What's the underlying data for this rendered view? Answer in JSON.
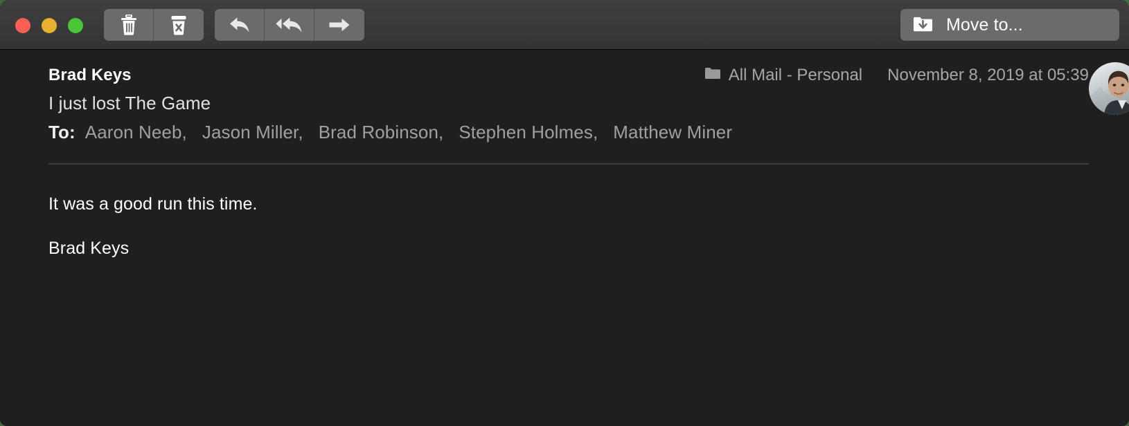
{
  "window": {
    "traffic_lights": [
      {
        "name": "close",
        "color": "#ff5f57"
      },
      {
        "name": "minimize",
        "color": "#e6b22e"
      },
      {
        "name": "maximize",
        "color": "#47c637"
      }
    ],
    "background_color": "#1f1f1f",
    "toolbar_color": "#3a3a3a"
  },
  "toolbar": {
    "delete_group": [
      {
        "icon": "trash-icon",
        "label": "Delete"
      },
      {
        "icon": "junk-icon",
        "label": "Move to Junk"
      }
    ],
    "reply_group": [
      {
        "icon": "reply-icon",
        "label": "Reply"
      },
      {
        "icon": "reply-all-icon",
        "label": "Reply All"
      },
      {
        "icon": "forward-icon",
        "label": "Forward"
      }
    ],
    "move_to": {
      "label": "Move to...",
      "icon": "move-to-folder-icon"
    }
  },
  "message": {
    "sender": "Brad Keys",
    "subject": "I just lost The Game",
    "to_label": "To:",
    "recipients": [
      "Aaron Neeb,",
      "Jason Miller,",
      "Brad Robinson,",
      "Stephen Holmes,",
      "Matthew Miner"
    ],
    "mailbox": "All Mail - Personal",
    "mailbox_icon": "folder-icon",
    "date": "November 8, 2019 at 05:39",
    "avatar": "sender-avatar-photo",
    "body_paragraphs": [
      "It was a good run this time.",
      "Brad Keys"
    ]
  }
}
